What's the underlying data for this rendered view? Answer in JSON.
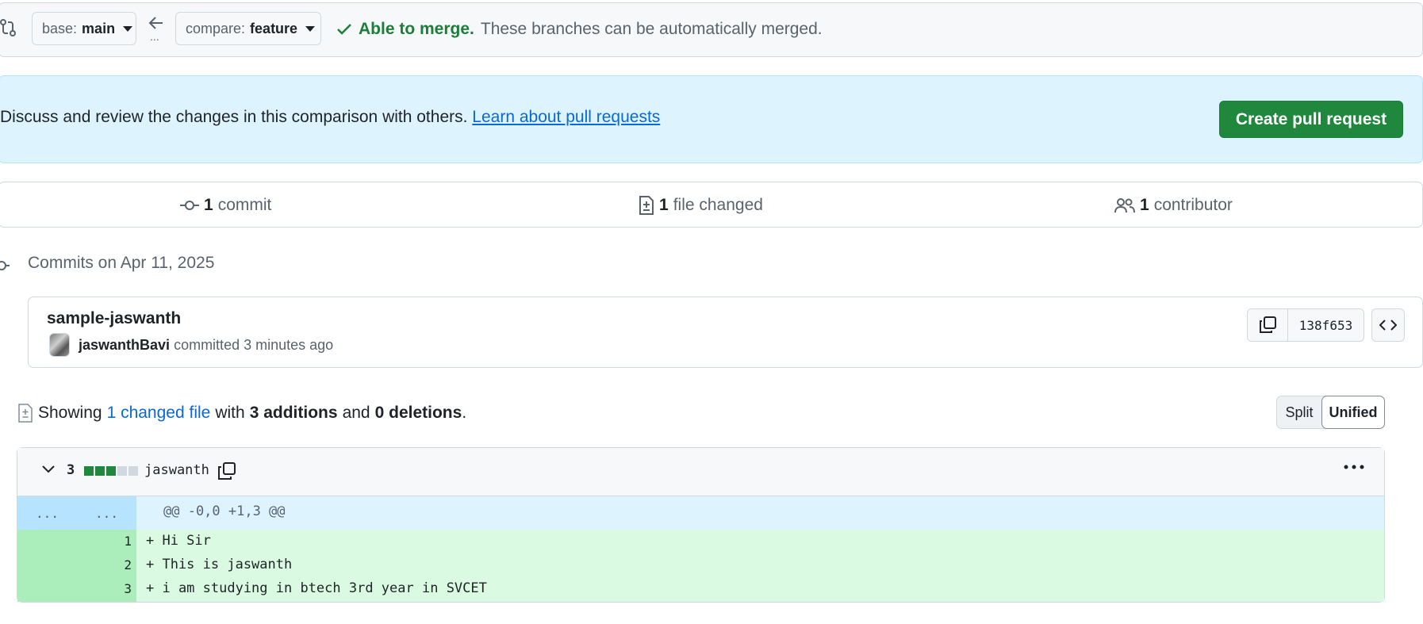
{
  "range": {
    "base_prefix": "base:",
    "base_branch": "main",
    "compare_prefix": "compare:",
    "compare_branch": "feature",
    "ellipsis": "...",
    "merge_status": "Able to merge.",
    "merge_detail": "These branches can be automatically merged."
  },
  "blurb": {
    "text": "Discuss and review the changes in this comparison with others.",
    "link": "Learn about pull requests",
    "button": "Create pull request"
  },
  "summary": {
    "commits_count": "1",
    "commits_label": "commit",
    "files_count": "1",
    "files_label": "file changed",
    "contributors_count": "1",
    "contributors_label": "contributor"
  },
  "commits": {
    "heading": "Commits on Apr 11, 2025",
    "items": [
      {
        "title": "sample-jaswanth",
        "author": "jaswanthBavi",
        "action": "committed 3 minutes ago",
        "sha": "138f653"
      }
    ]
  },
  "diff_summary": {
    "showing": "Showing",
    "changed_files": "1 changed file",
    "with": "with",
    "additions": "3 additions",
    "and": "and",
    "deletions": "0 deletions",
    "period": ".",
    "split": "Split",
    "unified": "Unified"
  },
  "file": {
    "change_count": "3",
    "diffstat": {
      "added_blocks": 3,
      "neutral_blocks": 2
    },
    "name": "jaswanth",
    "hunk_old": "...",
    "hunk_new": "...",
    "hunk_header": "@@ -0,0 +1,3 @@",
    "lines": [
      {
        "num": "1",
        "text": "+ Hi Sir"
      },
      {
        "num": "2",
        "text": "+ This is jaswanth"
      },
      {
        "num": "3",
        "text": "+ i am studying in btech 3rd year in SVCET"
      }
    ]
  },
  "colors": {
    "added_block": "#1f883d",
    "neutral_block": "#d1d9e0",
    "merge_ok": "#1a7f37",
    "link": "#0969da"
  }
}
